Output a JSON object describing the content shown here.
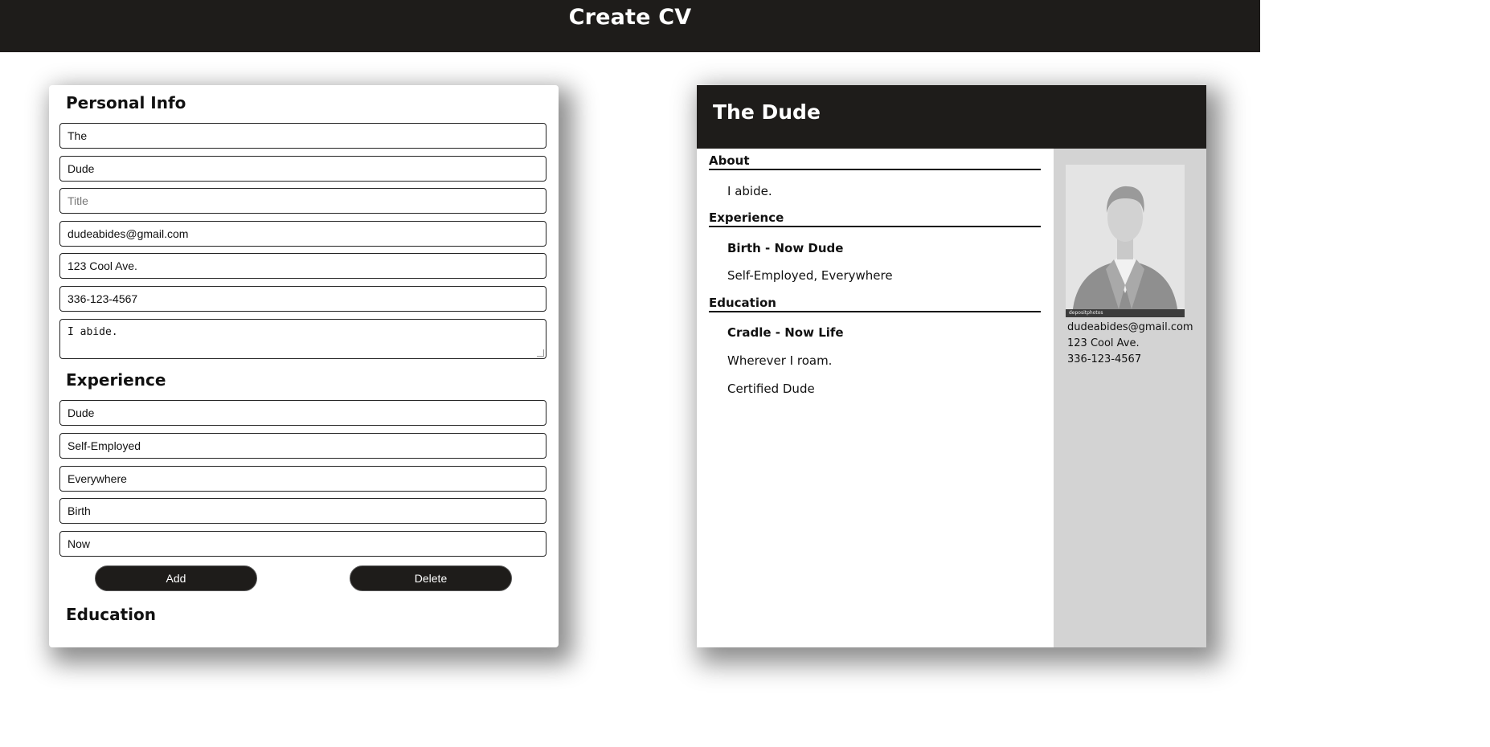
{
  "app": {
    "title": "Create CV"
  },
  "form": {
    "personal_heading": "Personal Info",
    "first_name": "The",
    "last_name": "Dude",
    "title_placeholder": "Title",
    "email": "dudeabides@gmail.com",
    "address": "123 Cool Ave.",
    "phone": "336-123-4567",
    "about": "I abide.",
    "experience_heading": "Experience",
    "exp_position": "Dude",
    "exp_company": "Self-Employed",
    "exp_location": "Everywhere",
    "exp_from": "Birth",
    "exp_to": "Now",
    "add_label": "Add",
    "delete_label": "Delete",
    "education_heading": "Education"
  },
  "cv": {
    "name": "The Dude",
    "about_heading": "About",
    "about_text": "I abide.",
    "experience_heading": "Experience",
    "exp_line1": "Birth -  Now  Dude",
    "exp_line2": "Self-Employed, Everywhere",
    "education_heading": "Education",
    "edu_line1": "Cradle -  Now  Life",
    "edu_line2": "Wherever I roam.",
    "edu_line3": "Certified Dude",
    "photo_watermark": "depositphotos",
    "email": "dudeabides@gmail.com",
    "address": "123 Cool Ave.",
    "phone": "336-123-4567"
  },
  "icons": {
    "photo": "avatar-placeholder-icon"
  }
}
